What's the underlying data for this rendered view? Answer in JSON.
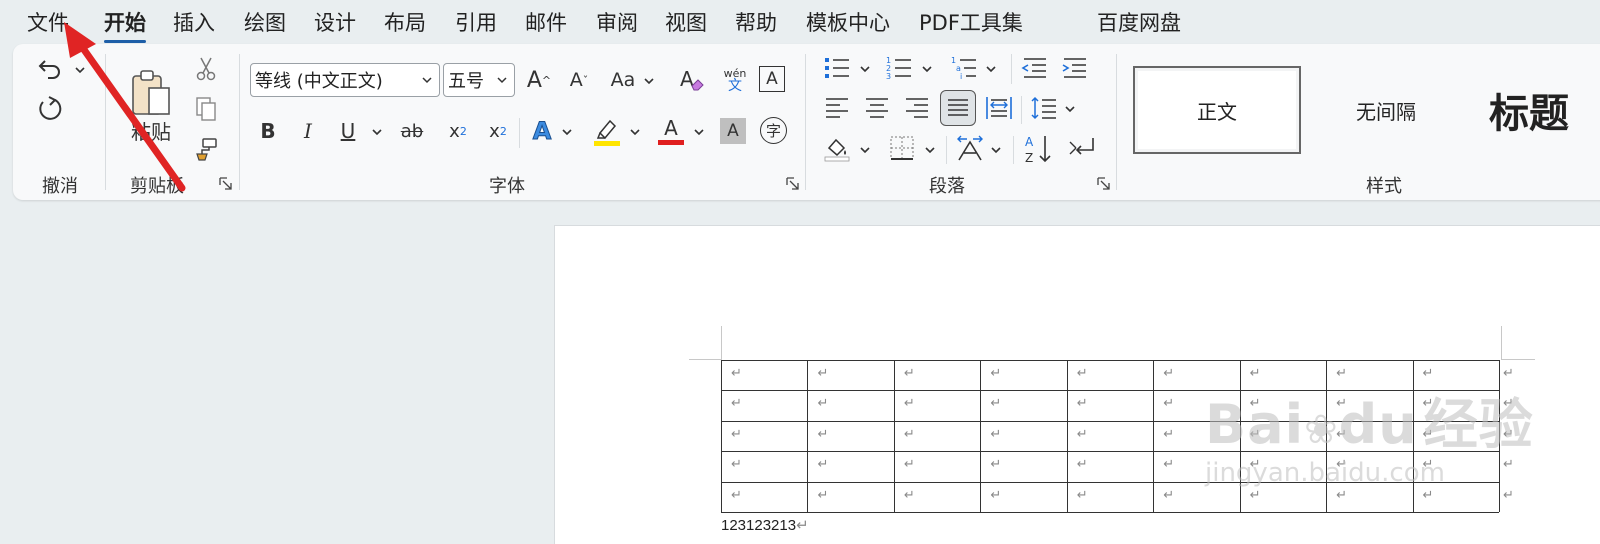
{
  "menu": {
    "tabs": [
      "文件",
      "开始",
      "插入",
      "绘图",
      "设计",
      "布局",
      "引用",
      "邮件",
      "审阅",
      "视图",
      "帮助",
      "模板中心",
      "PDF工具集",
      "百度网盘"
    ],
    "active": "开始"
  },
  "ribbon": {
    "undo_group": "撤消",
    "clipboard": {
      "label": "剪贴板",
      "paste": "粘贴"
    },
    "font": {
      "label": "字体",
      "font_name": "等线 (中文正文)",
      "font_size": "五号",
      "grow": "A",
      "shrink": "A",
      "case": "Aa",
      "phonetic_top": "wén",
      "phonetic_bottom": "文",
      "bold": "B",
      "italic": "I",
      "underline": "U",
      "strike": "ab",
      "subscript": "x",
      "superscript": "x",
      "effects": "A",
      "font_color": "A",
      "shading": "A",
      "enclose": "字",
      "border_char": "A"
    },
    "paragraph": {
      "label": "段落"
    },
    "styles": {
      "label": "样式",
      "items": [
        "正文",
        "无间隔",
        "标题"
      ]
    }
  },
  "document": {
    "text": "123123213",
    "paragraph_mark": "↵",
    "table_rows": 5,
    "table_cols": 9
  },
  "watermark": {
    "brand": "Bai",
    "brand2": "du",
    "cn": "经验",
    "url": "jingyan.baidu.com"
  },
  "colors": {
    "accent": "#1e5fa8",
    "highlight": "#ffe500",
    "font_color": "#e01f1f",
    "annotation_arrow": "#e02424"
  }
}
